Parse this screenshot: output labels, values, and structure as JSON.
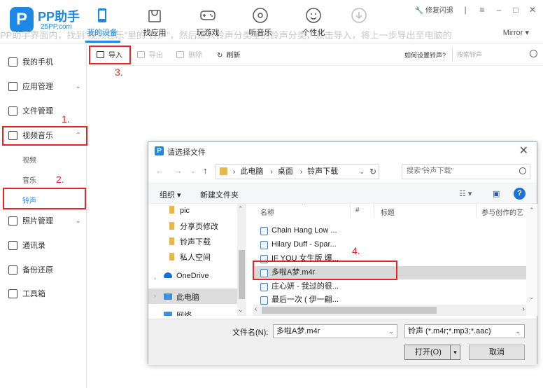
{
  "app": {
    "logo_letter": "P",
    "name": "PP助手",
    "site": "25PP.com",
    "banner": "PP助手界面内，找到“视频音乐”里的“铃声”，然后进入铃声分类里的铃声分类，点击导入，将上一步导出至电脑的",
    "top_right": {
      "repair": "修复闪退",
      "mirror": "Mirror"
    }
  },
  "nav_tabs": [
    {
      "label": "我的设备",
      "icon": "phone-icon",
      "active": true
    },
    {
      "label": "找应用",
      "icon": "shopping-bag-icon"
    },
    {
      "label": "玩游戏",
      "icon": "gamepad-icon"
    },
    {
      "label": "听音乐",
      "icon": "music-disc-icon"
    },
    {
      "label": "个性化",
      "icon": "smiley-icon"
    },
    {
      "label": "",
      "icon": "download-icon"
    }
  ],
  "sidebar": {
    "items": [
      {
        "label": "我的手机",
        "icon": "phone-icon"
      },
      {
        "label": "应用管理",
        "icon": "apps-icon"
      },
      {
        "label": "文件管理",
        "icon": "file-icon"
      },
      {
        "label": "视频音乐",
        "icon": "video-icon"
      },
      {
        "label": "照片管理",
        "icon": "photo-icon"
      },
      {
        "label": "通讯录",
        "icon": "contacts-icon"
      },
      {
        "label": "备份还原",
        "icon": "backup-icon"
      },
      {
        "label": "工具箱",
        "icon": "toolbox-icon"
      }
    ],
    "sub_items": [
      "视频",
      "音乐",
      "铃声"
    ]
  },
  "toolbar": {
    "import": "导入",
    "export": "导出",
    "delete": "删除",
    "refresh": "刷新",
    "howto": "如何设置铃声?",
    "search_placeholder": "搜索铃声"
  },
  "steps": [
    "1.",
    "2.",
    "3.",
    "4."
  ],
  "dialog": {
    "title": "请选择文件",
    "breadcrumb": [
      "此电脑",
      "桌面",
      "铃声下载"
    ],
    "search_placeholder": "搜索\"铃声下载\"",
    "organize": "组织 ▾",
    "new_folder": "新建文件夹",
    "tree": [
      "pic",
      "分享页修改",
      "铃声下载",
      "私人空间",
      "OneDrive",
      "此电脑",
      "网络"
    ],
    "columns": [
      "名称",
      "#",
      "标题",
      "参与创作的艺"
    ],
    "files": [
      "Chain Hang Low ...",
      "Hilary Duff - Spar...",
      "IF YOU 女生版 爆...",
      "多啦A梦.m4r",
      "庄心妍 - 我过的很...",
      "最后一次 ( 伊一翩..."
    ],
    "filename_label": "文件名(N):",
    "filename_value": "多啦A梦.m4r",
    "filetype": "铃声 (*.m4r;*.mp3;*.aac)",
    "open": "打开(O)",
    "cancel": "取消"
  },
  "colors": {
    "accent": "#1e88e5",
    "annotation": "#ee2222"
  }
}
